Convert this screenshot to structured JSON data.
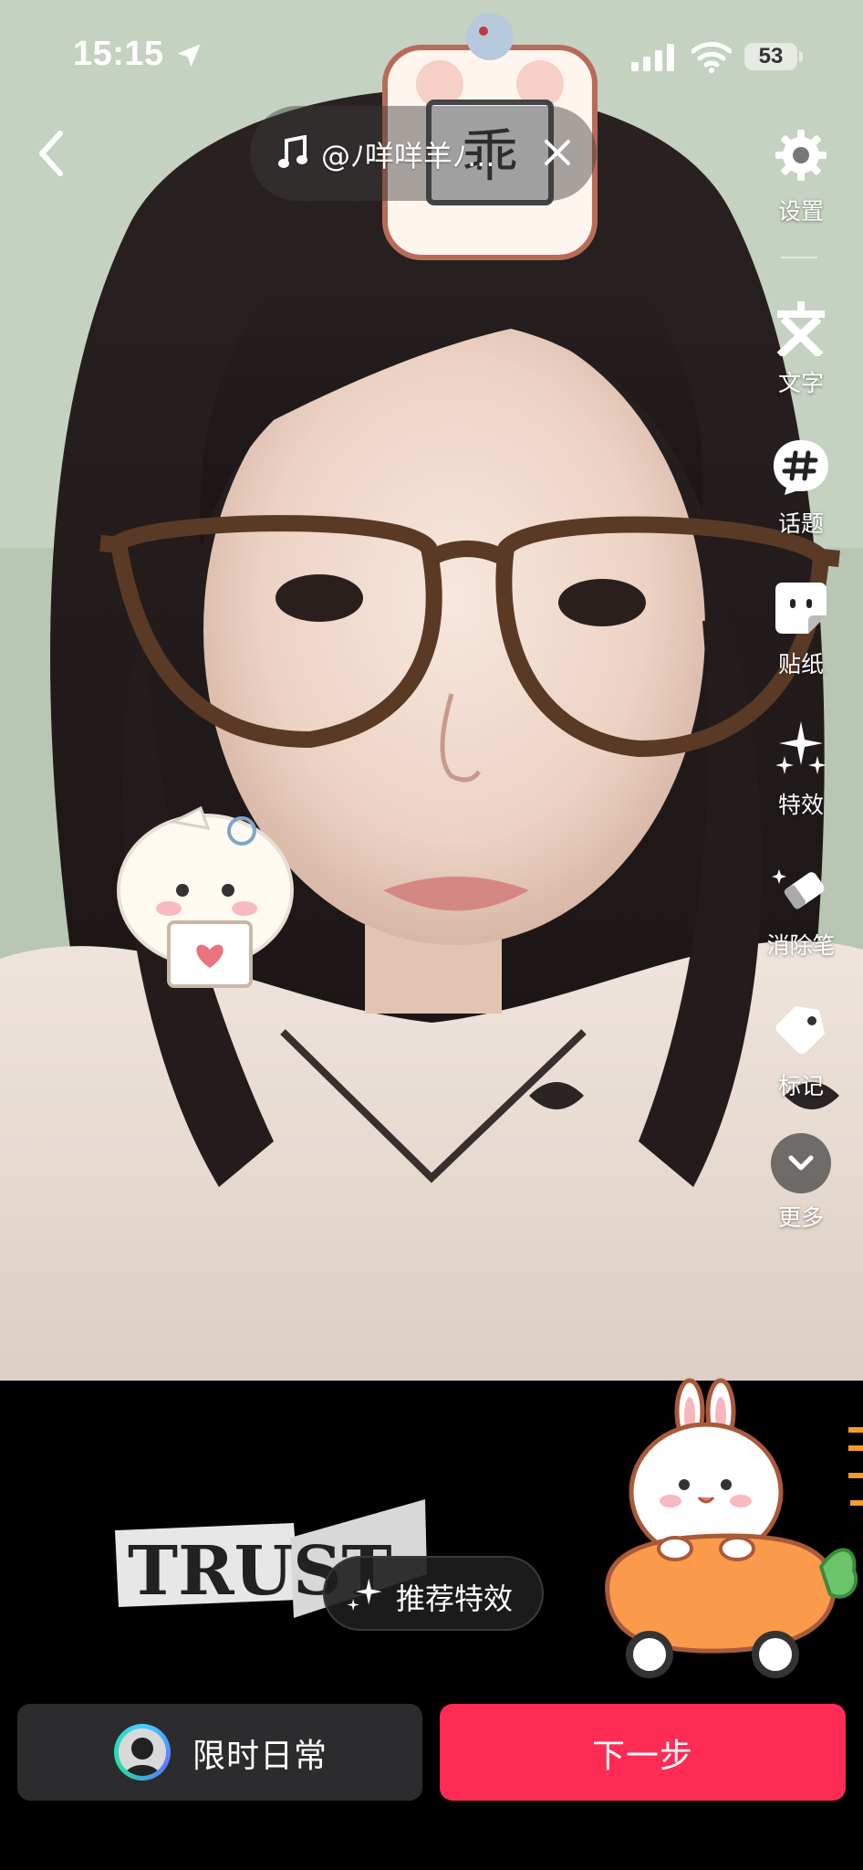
{
  "status_bar": {
    "time": "15:15",
    "battery": "53"
  },
  "top_bar": {
    "music_title": "@ﾉ咩咩羊ﾉ..."
  },
  "toolbar": [
    {
      "label": "设置",
      "icon": "gear-icon"
    },
    {
      "label": "文字",
      "icon": "text-icon"
    },
    {
      "label": "话题",
      "icon": "hashtag-icon"
    },
    {
      "label": "贴纸",
      "icon": "sticker-icon"
    },
    {
      "label": "特效",
      "icon": "sparkles-icon"
    },
    {
      "label": "消除笔",
      "icon": "eraser-icon"
    },
    {
      "label": "标记",
      "icon": "tag-icon"
    },
    {
      "label": "更多",
      "icon": "chevron-down-icon"
    }
  ],
  "effects": {
    "label": "推荐特效"
  },
  "stickers": {
    "trust_text": "TRUST",
    "top_badge_char": "乖"
  },
  "actions": {
    "daily_label": "限时日常",
    "next_label": "下一步"
  },
  "colors": {
    "accent": "#fe2c55",
    "panel": "#2c2c2e"
  }
}
